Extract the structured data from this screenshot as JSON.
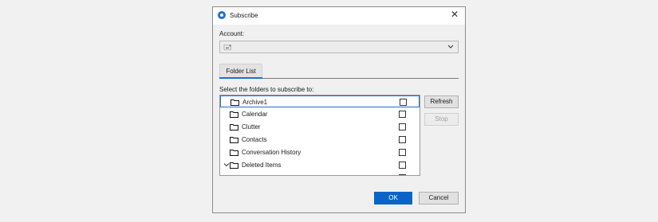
{
  "window": {
    "title": "Subscribe",
    "close_glyph": "✕"
  },
  "account": {
    "label": "Account:",
    "selected_icon": "account-card-icon",
    "selected_glyph": "🖃"
  },
  "tabs": [
    {
      "label": "Folder List",
      "active": true
    }
  ],
  "folders": {
    "label": "Select the folders to subscribe to:",
    "items": [
      {
        "name": "Archive1",
        "checked": false,
        "selected": true
      },
      {
        "name": "Calendar",
        "checked": false
      },
      {
        "name": "Clutter",
        "checked": false
      },
      {
        "name": "Contacts",
        "checked": false
      },
      {
        "name": "Conversation History",
        "checked": false
      },
      {
        "name": "Deleted Items",
        "checked": false,
        "expanded": true
      },
      {
        "name": "",
        "checked": false,
        "child": true
      }
    ]
  },
  "buttons": {
    "refresh": "Refresh",
    "stop": "Stop",
    "ok": "OK",
    "cancel": "Cancel"
  },
  "colors": {
    "accent": "#0a64c8",
    "selection": "#1f6fd1"
  }
}
